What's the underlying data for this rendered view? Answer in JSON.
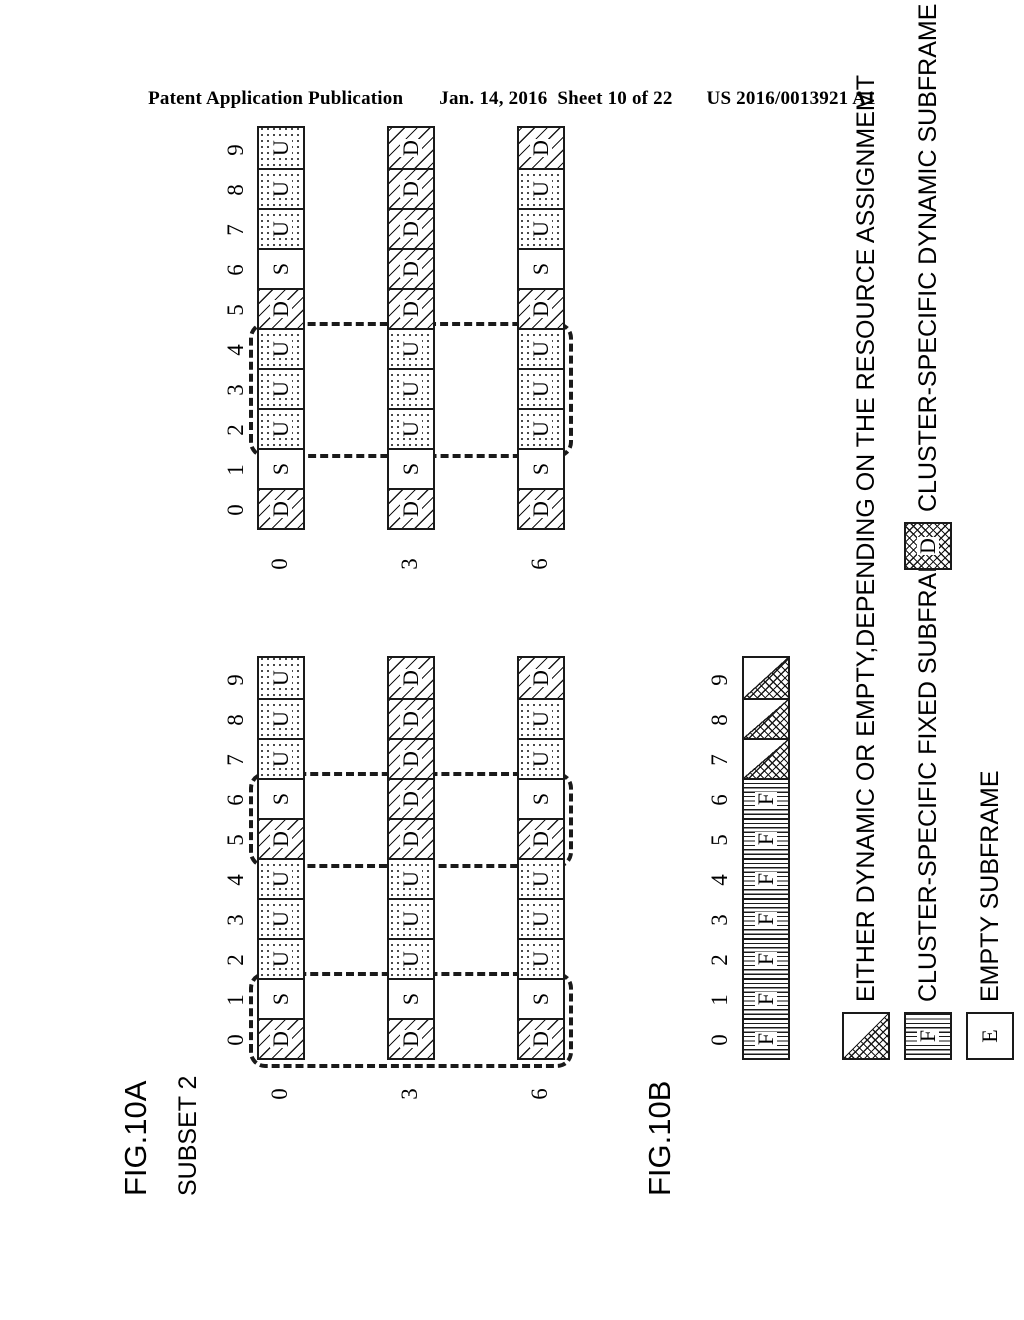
{
  "header": {
    "publication": "Patent Application Publication",
    "date": "Jan. 14, 2016",
    "sheet": "Sheet 10 of 22",
    "docnum": "US 2016/0013921 A1"
  },
  "figures": {
    "fig10a": {
      "label": "FIG.10A",
      "subset_label": "SUBSET 2",
      "index_labels": [
        "0",
        "1",
        "2",
        "3",
        "4",
        "5",
        "6",
        "7",
        "8",
        "9"
      ],
      "row_labels": [
        "0",
        "3",
        "6"
      ],
      "left_block": {
        "rows": [
          {
            "label": "0",
            "cells": [
              "D",
              "S",
              "U",
              "U",
              "U",
              "D",
              "S",
              "U",
              "U",
              "U"
            ]
          },
          {
            "label": "3",
            "cells": [
              "D",
              "S",
              "U",
              "U",
              "U",
              "D",
              "D",
              "D",
              "D",
              "D"
            ]
          },
          {
            "label": "6",
            "cells": [
              "D",
              "S",
              "U",
              "U",
              "U",
              "D",
              "S",
              "U",
              "U",
              "D"
            ]
          }
        ],
        "dashed_spans": [
          [
            0,
            1
          ],
          [
            5,
            6
          ]
        ]
      },
      "right_block": {
        "rows": [
          {
            "label": "0",
            "cells": [
              "D",
              "S",
              "U",
              "U",
              "U",
              "D",
              "S",
              "U",
              "U",
              "U"
            ]
          },
          {
            "label": "3",
            "cells": [
              "D",
              "S",
              "U",
              "U",
              "U",
              "D",
              "D",
              "D",
              "D",
              "D"
            ]
          },
          {
            "label": "6",
            "cells": [
              "D",
              "S",
              "U",
              "U",
              "U",
              "D",
              "S",
              "U",
              "U",
              "D"
            ]
          }
        ],
        "dashed_spans": [
          [
            2,
            4
          ]
        ]
      }
    },
    "fig10b": {
      "label": "FIG.10B",
      "index_labels": [
        "0",
        "1",
        "2",
        "3",
        "4",
        "5",
        "6",
        "7",
        "8",
        "9"
      ],
      "cells": [
        "F",
        "F",
        "F",
        "F",
        "F",
        "F",
        "F",
        "X",
        "X",
        "X"
      ]
    }
  },
  "legend": {
    "items": [
      {
        "swatch": "X",
        "swatch_glyph": "",
        "text": "EITHER DYNAMIC OR EMPTY,DEPENDING ON THE RESOURCE ASSIGNMEMT"
      },
      {
        "swatch": "F",
        "swatch_glyph": "F",
        "text": "CLUSTER-SPECIFIC FIXED SUBFRAME"
      },
      {
        "swatch": "E",
        "swatch_glyph": "E",
        "text": "EMPTY SUBFRAME"
      },
      {
        "swatch": "Xd",
        "swatch_glyph": "D",
        "text": "CLUSTER-SPECIFIC DYNAMIC SUBFRAME"
      }
    ]
  },
  "colors": {
    "ink": "#1a1a1a",
    "paper": "#ffffff"
  }
}
